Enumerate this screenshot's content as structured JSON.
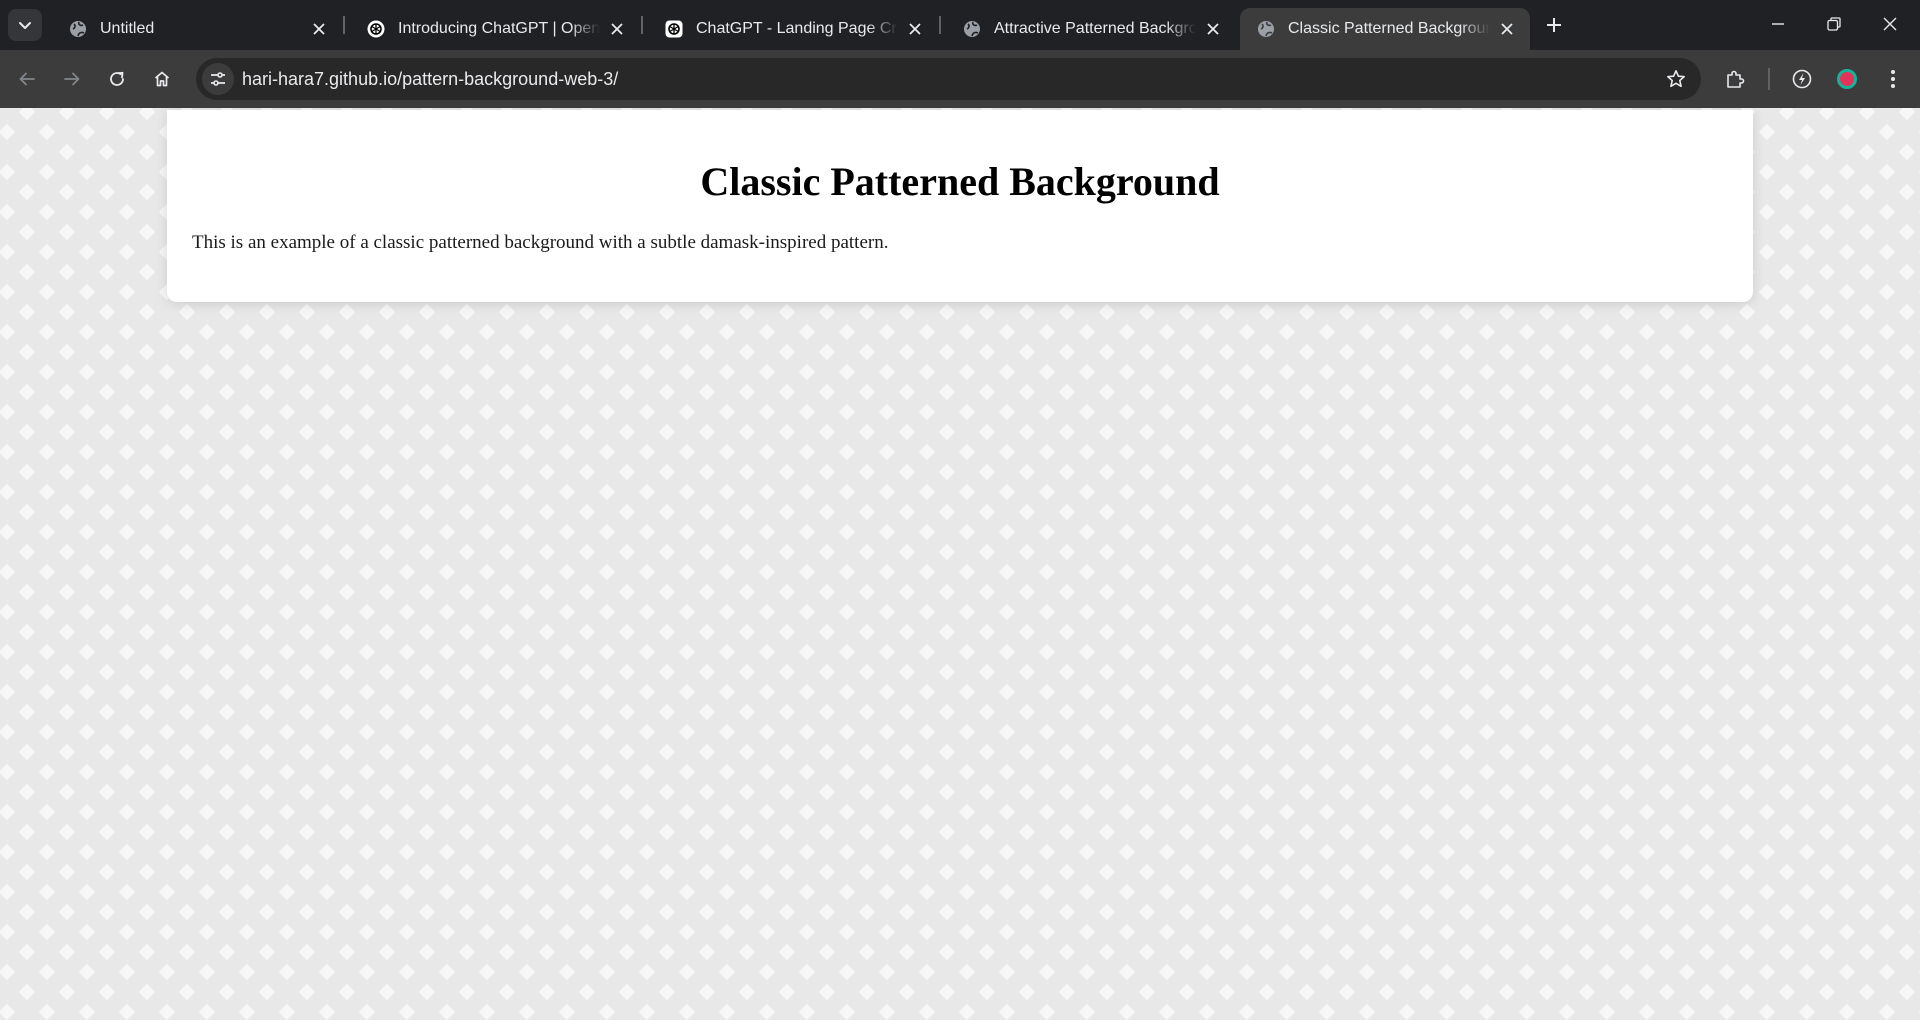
{
  "browser": {
    "tabs": [
      {
        "title": "Untitled",
        "favicon": "globe-icon",
        "active": false
      },
      {
        "title": "Introducing ChatGPT | OpenAI",
        "favicon": "openai-icon",
        "active": false
      },
      {
        "title": "ChatGPT - Landing Page Creator",
        "favicon": "openai-icon",
        "active": false
      },
      {
        "title": "Attractive Patterned Background",
        "favicon": "globe-icon",
        "active": false
      },
      {
        "title": "Classic Patterned Background",
        "favicon": "globe-icon",
        "active": true
      }
    ],
    "url": "hari-hara7.github.io/pattern-background-web-3/",
    "colors": {
      "frame": "#202124",
      "toolbar": "#3c3c3c",
      "omnibox": "#282828",
      "text": "#e8eaed"
    }
  },
  "page": {
    "heading": "Classic Patterned Background",
    "description": "This is an example of a classic patterned background with a subtle damask-inspired pattern.",
    "colors": {
      "card": "#ffffff",
      "pattern_light": "#f7f7f7",
      "pattern_dark": "#e8e8e8"
    }
  }
}
